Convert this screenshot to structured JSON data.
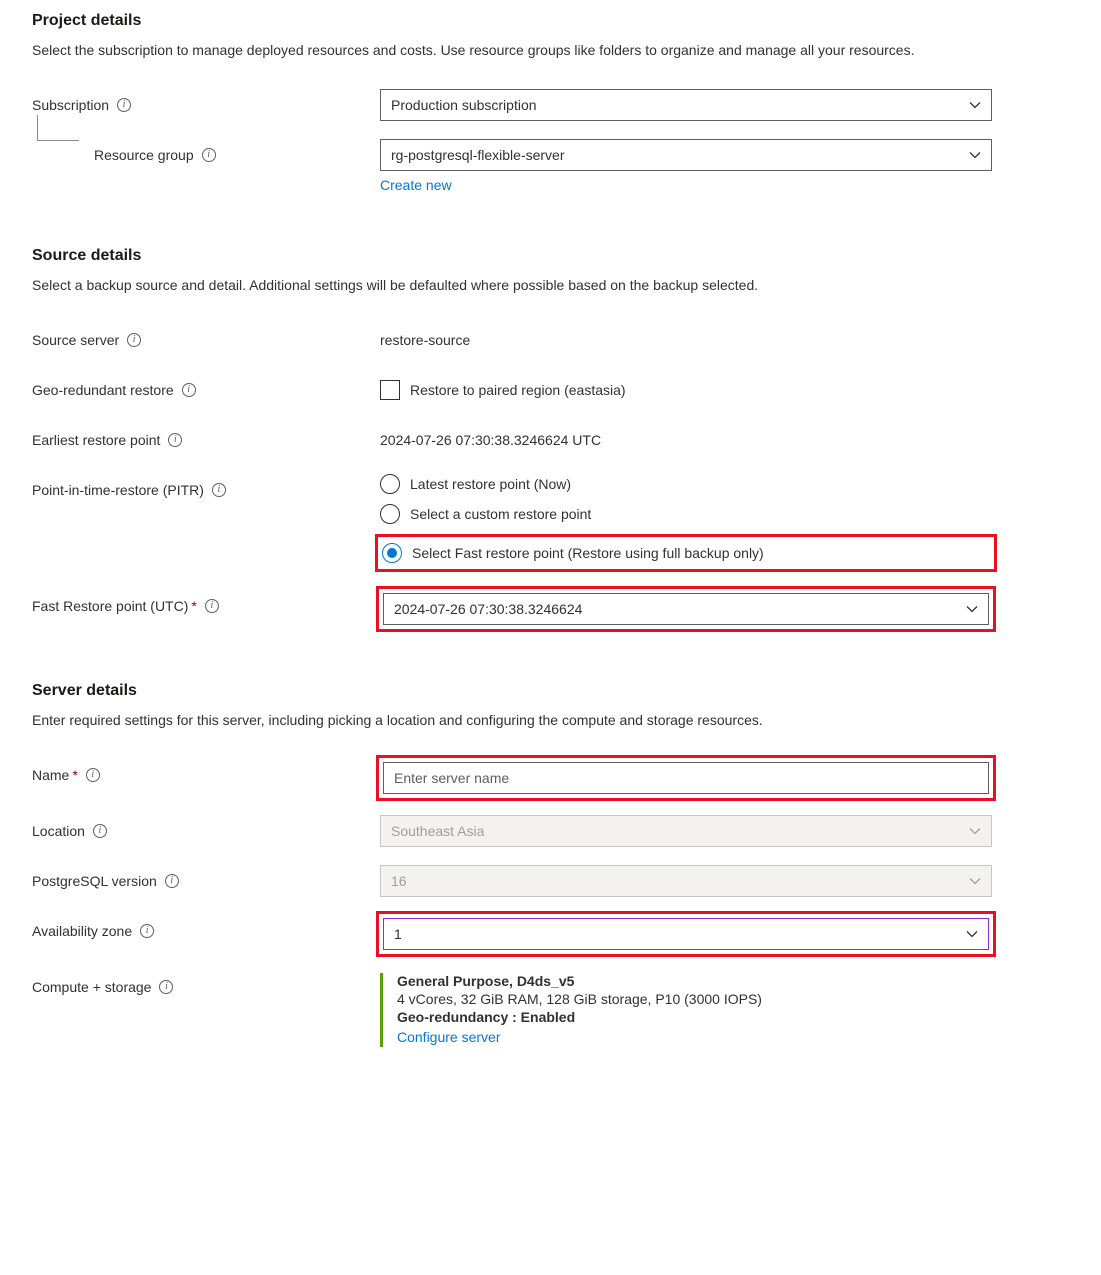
{
  "project": {
    "heading": "Project details",
    "desc": "Select the subscription to manage deployed resources and costs. Use resource groups like folders to organize and manage all your resources.",
    "subscription_label": "Subscription",
    "subscription_value": "Production subscription",
    "resource_group_label": "Resource group",
    "resource_group_value": "rg-postgresql-flexible-server",
    "create_new": "Create new"
  },
  "source": {
    "heading": "Source details",
    "desc": "Select a backup source and detail. Additional settings will be defaulted where possible based on the backup selected.",
    "source_server_label": "Source server",
    "source_server_value": "restore-source",
    "geo_label": "Geo-redundant restore",
    "geo_checkbox_label": "Restore to paired region (eastasia)",
    "earliest_label": "Earliest restore point",
    "earliest_value": "2024-07-26 07:30:38.3246624 UTC",
    "pitr_label": "Point-in-time-restore (PITR)",
    "pitr_options": {
      "latest": "Latest restore point (Now)",
      "custom": "Select a custom restore point",
      "fast": "Select Fast restore point (Restore using full backup only)"
    },
    "fast_restore_label": "Fast Restore point (UTC)",
    "fast_restore_value": "2024-07-26 07:30:38.3246624"
  },
  "server": {
    "heading": "Server details",
    "desc": "Enter required settings for this server, including picking a location and configuring the compute and storage resources.",
    "name_label": "Name",
    "name_placeholder": "Enter server name",
    "location_label": "Location",
    "location_value": "Southeast Asia",
    "pg_version_label": "PostgreSQL version",
    "pg_version_value": "16",
    "az_label": "Availability zone",
    "az_value": "1",
    "compute_label": "Compute + storage",
    "compute": {
      "sku": "General Purpose, D4ds_v5",
      "spec": "4 vCores, 32 GiB RAM, 128 GiB storage, P10 (3000 IOPS)",
      "geo": "Geo-redundancy : Enabled",
      "configure": "Configure server"
    }
  }
}
